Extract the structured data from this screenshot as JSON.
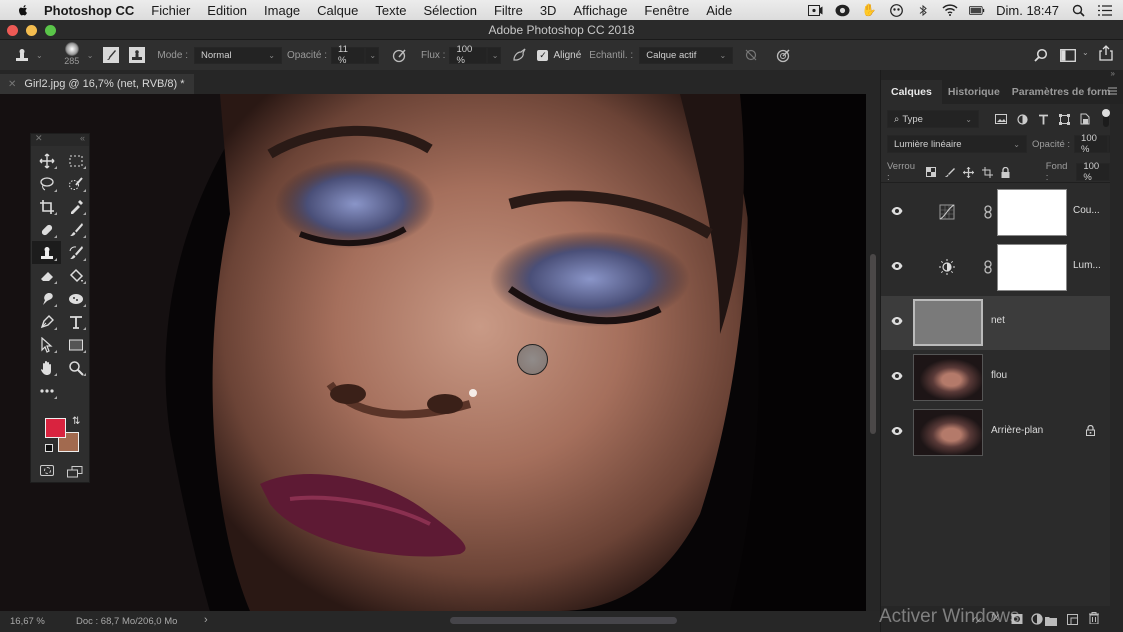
{
  "menubar": {
    "app_name": "Photoshop CC",
    "menus": [
      "Fichier",
      "Edition",
      "Image",
      "Calque",
      "Texte",
      "Sélection",
      "Filtre",
      "3D",
      "Affichage",
      "Fenêtre",
      "Aide"
    ],
    "clock": "Dim. 18:47",
    "tray_icons": [
      "screen-record-icon",
      "creative-cloud-icon",
      "hand-app-icon",
      "face-app-icon",
      "bluetooth-icon",
      "wifi-icon",
      "battery-icon",
      "spotlight-icon",
      "notification-list-icon"
    ]
  },
  "window": {
    "title": "Adobe Photoshop CC 2018",
    "colors": {
      "close": "#ee5a55",
      "minimize": "#f4bd4f",
      "zoom": "#5ac549"
    }
  },
  "options_bar": {
    "brush_size": "285",
    "mode_label": "Mode :",
    "mode_value": "Normal",
    "opacity_label": "Opacité :",
    "opacity_value": "11 %",
    "flow_label": "Flux :",
    "flow_value": "100 %",
    "aligned_label": "Aligné",
    "aligned_checked": true,
    "sample_label": "Echantil. :",
    "sample_value": "Calque actif"
  },
  "document": {
    "tab_title": "Girl2.jpg @ 16,7% (net, RVB/8) *",
    "zoom": "16,67 %",
    "doc_info": "Doc : 68,7 Mo/206,0 Mo"
  },
  "toolbox": {
    "tools": [
      "move",
      "marquee",
      "lasso",
      "quick-select",
      "crop",
      "eyedropper",
      "healing",
      "brush",
      "clone-stamp",
      "history-brush",
      "eraser",
      "paint-bucket",
      "blur",
      "dodge",
      "pen",
      "type",
      "path-select",
      "rectangle",
      "hand",
      "zoom",
      "more"
    ],
    "active_tool": "clone-stamp",
    "foreground_color": "#d9233f",
    "background_color": "#a26a4f"
  },
  "layers_panel": {
    "tabs": [
      "Calques",
      "Historique",
      "Paramètres de form"
    ],
    "active_tab": "Calques",
    "filter_type": "Type",
    "blend_mode": "Lumière linéaire",
    "opacity_label": "Opacité :",
    "opacity_value": "100 %",
    "lock_label": "Verrou :",
    "fill_label": "Fond :",
    "fill_value": "100 %",
    "layers": [
      {
        "name": "Cou...",
        "type": "curves-adjustment",
        "visible": true,
        "selected": false
      },
      {
        "name": "Lum...",
        "type": "brightness-adjustment",
        "visible": true,
        "selected": false
      },
      {
        "name": "net",
        "type": "pixel-gray",
        "visible": true,
        "selected": true
      },
      {
        "name": "flou",
        "type": "pixel-photo",
        "visible": true,
        "selected": false
      },
      {
        "name": "Arrière-plan",
        "type": "background",
        "visible": true,
        "selected": false,
        "locked": true
      }
    ]
  },
  "overlay": {
    "watermark": "Activer Windows"
  }
}
